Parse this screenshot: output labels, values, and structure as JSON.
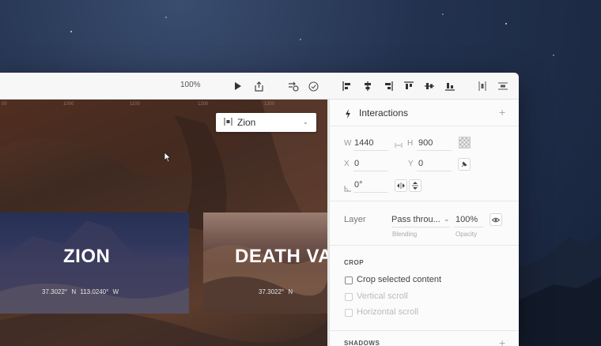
{
  "toolbar": {
    "zoom": "100%",
    "icons": [
      "play-icon",
      "share-icon",
      "boolean-icon",
      "check-circle-icon"
    ],
    "align_icons": [
      "align-left-icon",
      "align-center-h-icon",
      "align-right-icon",
      "align-top-icon",
      "align-middle-icon",
      "align-bottom-icon",
      "distribute-h-icon",
      "distribute-v-icon"
    ]
  },
  "canvas": {
    "ruler_ticks": [
      "00",
      "1000",
      "1100",
      "1200",
      "1300"
    ],
    "artboard_select": {
      "label": "Zion",
      "icon": "artboard-icon"
    },
    "cards": [
      {
        "title": "ZION",
        "coords": "37.3022° N   113.0240° W"
      },
      {
        "title": "DEATH VA",
        "coords": "37.3022° N"
      }
    ]
  },
  "inspector": {
    "interactions_label": "Interactions",
    "add_symbol": "+",
    "w_label": "W",
    "w_value": "1440",
    "h_label": "H",
    "h_value": "900",
    "x_label": "X",
    "x_value": "0",
    "y_label": "Y",
    "y_value": "0",
    "rotation_value": "0°",
    "layer_label": "Layer",
    "blending_value": "Pass throu...",
    "blending_label": "Blending",
    "opacity_value": "100%",
    "opacity_label": "Opacity",
    "crop_header": "CROP",
    "crop_items": [
      {
        "label": "Crop selected content",
        "enabled": true
      },
      {
        "label": "Vertical scroll",
        "enabled": false
      },
      {
        "label": "Horizontal scroll",
        "enabled": false
      }
    ],
    "shadows_header": "SHADOWS"
  },
  "colors": {
    "accent_text": "#444444",
    "disabled_text": "#bbbbbb"
  }
}
